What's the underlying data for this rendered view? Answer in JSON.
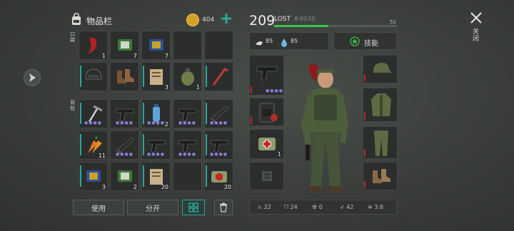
{
  "inventory": {
    "title": "物品栏",
    "coins": "404",
    "pocket_label": "口袋",
    "backpack_label": "背包"
  },
  "player": {
    "level": "209",
    "name": "LOST",
    "id": "#4938",
    "xp_level": "52",
    "food": "85",
    "water": "85",
    "skills_label": "技能"
  },
  "close_label": "关闭",
  "buttons": {
    "use": "使用",
    "split": "分开"
  },
  "rows": [
    [
      {
        "icon": "red-chili-icon",
        "count": "1"
      },
      {
        "icon": "green-card-icon",
        "count": "7"
      },
      {
        "icon": "blue-card-icon",
        "count": "7"
      },
      {
        "icon": "",
        "count": ""
      },
      {
        "icon": "",
        "count": ""
      }
    ],
    [
      {
        "icon": "helmet-icon",
        "count": ""
      },
      {
        "icon": "boots-icon",
        "count": ""
      },
      {
        "icon": "notebook-icon",
        "count": "3"
      },
      {
        "icon": "grenade-icon",
        "count": "1"
      },
      {
        "icon": "crowbar-icon",
        "count": ""
      }
    ],
    [
      {
        "icon": "ice-axe-icon",
        "count": ""
      },
      {
        "icon": "pistol-icon",
        "count": ""
      },
      {
        "icon": "water-bottle-icon",
        "count": "2"
      },
      {
        "icon": "pistol-icon",
        "count": ""
      },
      {
        "icon": "shotgun-icon",
        "count": ""
      }
    ],
    [
      {
        "icon": "carrot-icon",
        "count": "11"
      },
      {
        "icon": "shotgun-icon",
        "count": ""
      },
      {
        "icon": "pistol-icon",
        "count": ""
      },
      {
        "icon": "pistol-icon",
        "count": ""
      },
      {
        "icon": "pistol-icon",
        "count": ""
      }
    ],
    [
      {
        "icon": "blue-card-icon",
        "count": "3"
      },
      {
        "icon": "green-card-icon",
        "count": "2"
      },
      {
        "icon": "notebook-icon",
        "count": "20"
      },
      {
        "icon": "",
        "count": ""
      },
      {
        "icon": "medkit-icon",
        "count": "20"
      }
    ]
  ],
  "stats": {
    "attack": "22",
    "defense": "24",
    "radiation": "0",
    "speed": "42",
    "stealth": "3.8"
  },
  "colors": {
    "accent": "#2aa89a",
    "xp_bar": "#37c24a",
    "red_marker": "#b72b2b",
    "dots": "#8a7bd6"
  }
}
